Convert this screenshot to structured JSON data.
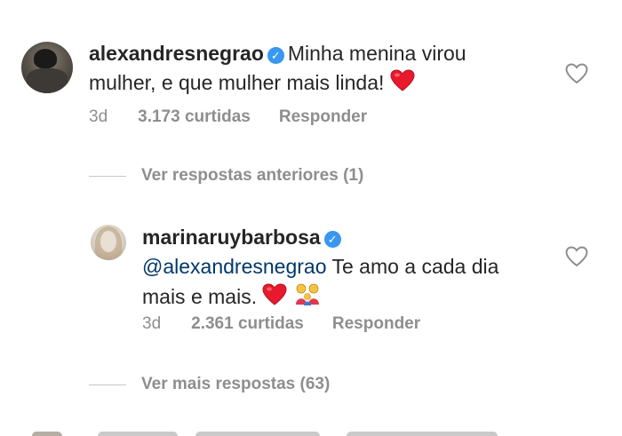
{
  "comment": {
    "username": "alexandresnegrao",
    "verified_icon": "verified-badge-icon",
    "text_line1": "Minha menina virou",
    "text_line2": "mulher, e que mulher mais linda!",
    "emoji_name": "red-heart",
    "time": "3d",
    "likes": "3.173 curtidas",
    "reply_label": "Responder"
  },
  "previous_replies": {
    "label": "Ver respostas anteriores (1)"
  },
  "reply": {
    "username": "marinaruybarbosa",
    "verified_icon": "verified-badge-icon",
    "mention": "@alexandresnegrao",
    "text_rest": "Te amo a cada dia",
    "text_line2": "mais e mais.",
    "emoji_names": [
      "red-heart",
      "family-emoji"
    ],
    "time": "3d",
    "likes": "2.361 curtidas",
    "reply_label": "Responder"
  },
  "more_replies": {
    "label": "Ver mais respostas (63)"
  },
  "colors": {
    "text": "#262626",
    "secondary": "#8e8e8e",
    "mention": "#00376b",
    "verified": "#3897f0",
    "heart_emoji": "#e8192c"
  }
}
